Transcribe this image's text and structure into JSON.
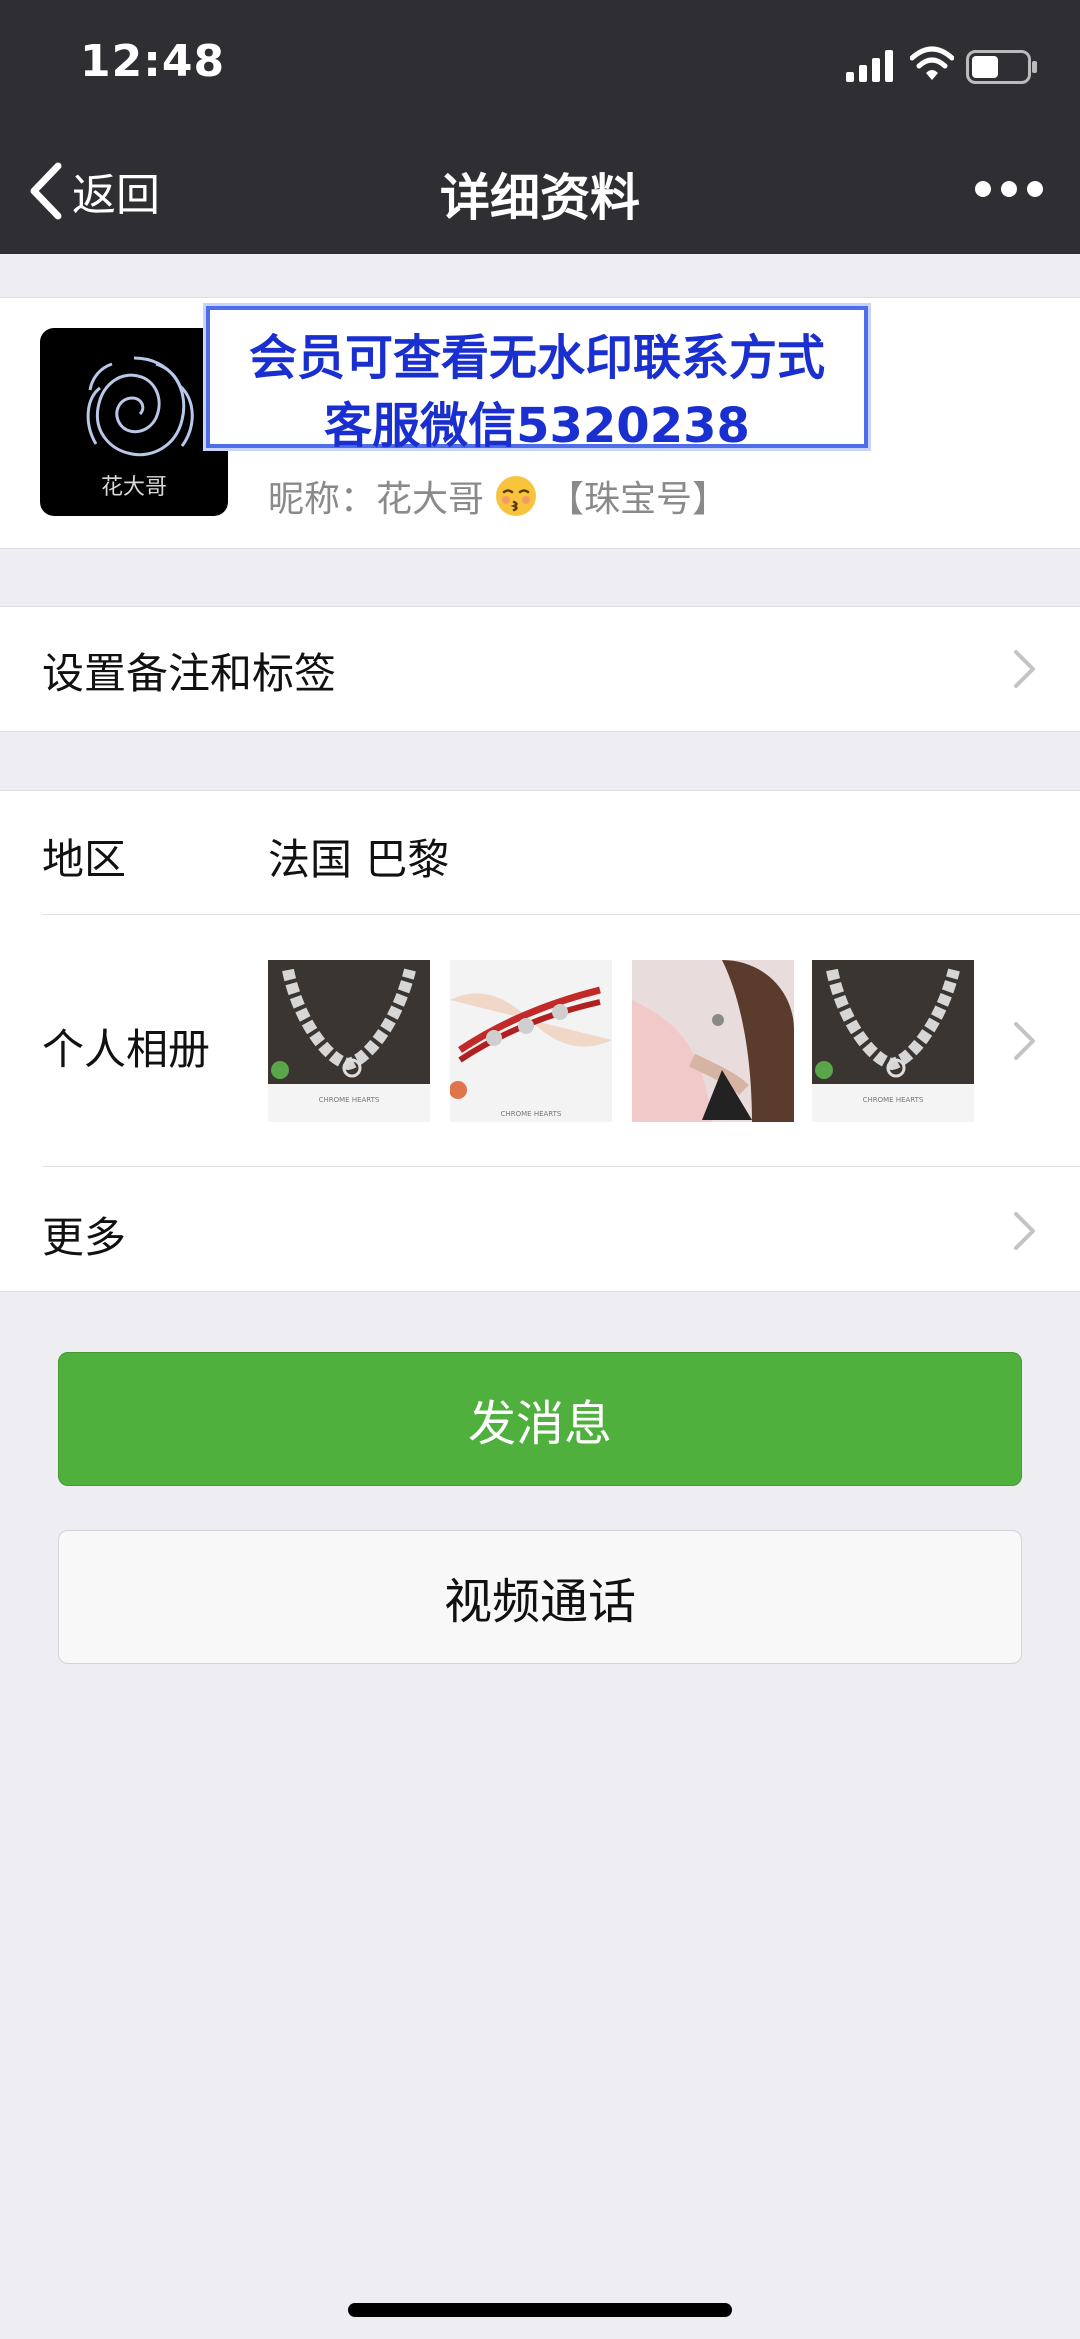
{
  "status_bar": {
    "time": "12:48"
  },
  "nav": {
    "back_label": "返回",
    "title": "详细资料"
  },
  "profile": {
    "avatar_text": "花大哥",
    "nickname_label": "昵称：",
    "nickname": "花大哥",
    "nickname_suffix": "【珠宝号】"
  },
  "watermark": {
    "line1": "会员可查看无水印联系方式",
    "line2": "客服微信5320238"
  },
  "menu": {
    "remark_label": "设置备注和标签",
    "more_label": "更多"
  },
  "region": {
    "label": "地区",
    "value": "法国 巴黎"
  },
  "album": {
    "label": "个人相册",
    "thumbnails": [
      {
        "caption": "CHROME HEARTS"
      },
      {
        "caption": "CHROME HEARTS"
      },
      {
        "caption": ""
      },
      {
        "caption": "CHROME HEARTS"
      }
    ]
  },
  "actions": {
    "send_label": "发消息",
    "video_label": "视频通话"
  },
  "colors": {
    "accent_green": "#4fb03e",
    "nav_bg": "#2f2f33",
    "watermark_blue": "#1a2fd0"
  }
}
